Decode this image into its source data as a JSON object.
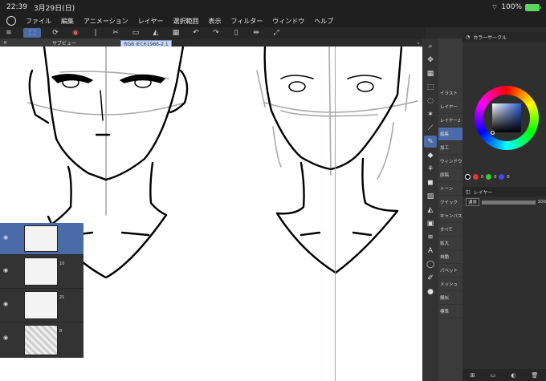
{
  "status": {
    "time": "22:39",
    "date": "3月29日(日)",
    "battery": "100%",
    "wifi_icon": "wifi-icon"
  },
  "menu": [
    "ファイル",
    "編集",
    "アニメーション",
    "レイヤー",
    "選択範囲",
    "表示",
    "フィルター",
    "ウィンドウ",
    "ヘルプ"
  ],
  "toolbar": {
    "icons": [
      "menu-icon",
      "save-icon",
      "redo-icon",
      "copy-icon",
      "fill-icon",
      "cut-icon",
      "undo-icon",
      "redo-icon",
      "transform-icon",
      "flip-icon",
      "export-icon"
    ]
  },
  "subview": {
    "tab_close": "✕",
    "tab_label": "サブビュー"
  },
  "canvas": {
    "color_profile": "RGB IEC61966-2.1"
  },
  "tools": [
    "search",
    "move",
    "grid",
    "lasso",
    "select",
    "pen",
    "brush",
    "airbrush",
    "eraser",
    "blend",
    "fill",
    "gradient",
    "shape",
    "frame",
    "ruler",
    "text",
    "balloon",
    "color-fill",
    "layer"
  ],
  "subtools": [
    "イラスト",
    "レイヤー",
    "レイヤー2",
    "編集",
    "加工",
    "ウィンドウ",
    "原稿",
    "トーン",
    "クイック",
    "キャンバス",
    "すべて",
    "拡大",
    "自動",
    "パペット",
    "メッシュ",
    "擬似",
    "標準"
  ],
  "panel": {
    "color_title": "カラーサークル",
    "layer_title": "レイヤー",
    "blend_mode": "通常",
    "opacity": "100",
    "swatch_vals": [
      "0",
      "0",
      "0"
    ],
    "layer_nums": [
      "",
      "10",
      "21",
      "8",
      ""
    ]
  },
  "colors": {
    "accent": "#4a6aa8",
    "guide": "#d983d9",
    "battery": "#5ad65a"
  }
}
